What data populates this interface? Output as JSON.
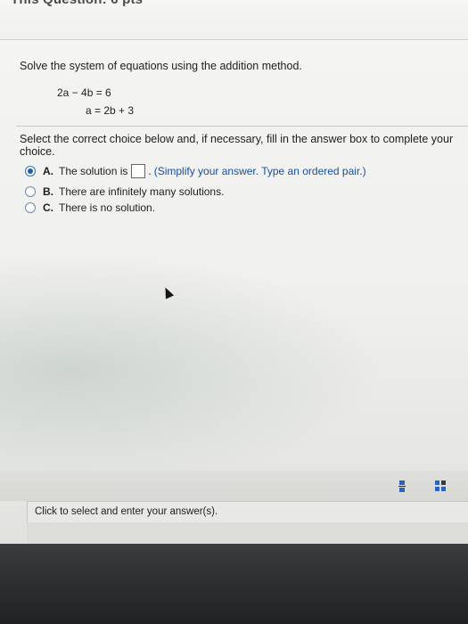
{
  "header": {
    "title": "This Question: 6 pts"
  },
  "question": {
    "instruction": "Solve the system of equations using the addition method.",
    "equations": [
      "2a − 4b  =  6",
      "a  =  2b + 3"
    ]
  },
  "prompt": "Select the correct choice below and, if necessary, fill in the answer box to complete your choice.",
  "choices": [
    {
      "letter": "A.",
      "text_before": "The solution is",
      "text_after": ".",
      "hint": "(Simplify your answer. Type an ordered pair.)",
      "selected": true
    },
    {
      "letter": "B.",
      "text": "There are infinitely many solutions.",
      "selected": false
    },
    {
      "letter": "C.",
      "text": "There is no solution.",
      "selected": false
    }
  ],
  "toolbar": {
    "icons": [
      "fraction-icon",
      "matrix-icon"
    ]
  },
  "footer": {
    "text": "Click to select and enter your answer(s)."
  },
  "colors": {
    "accent": "#1f5fa8",
    "hint": "#1a4fa0",
    "background": "#efefed"
  }
}
